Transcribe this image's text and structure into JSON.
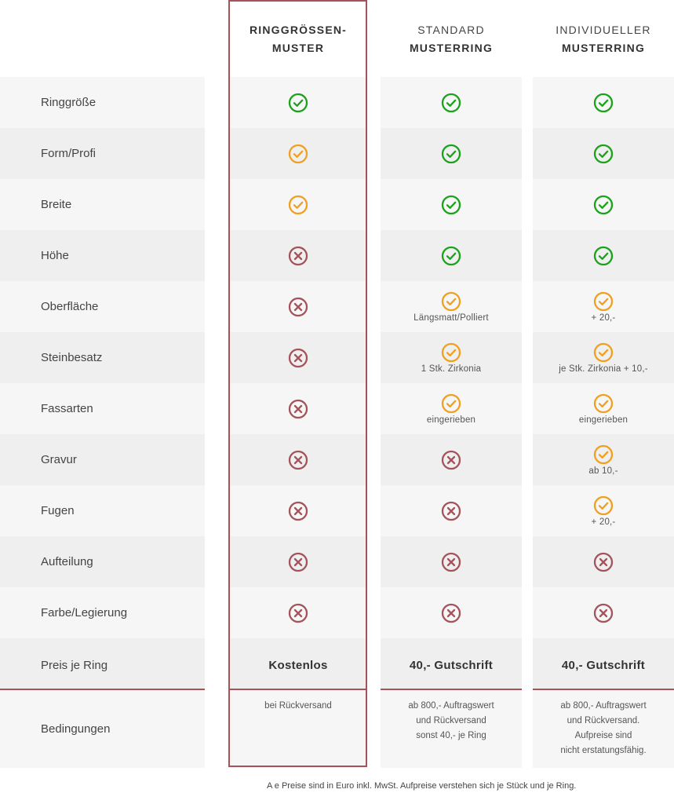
{
  "columns": [
    {
      "line1": "RINGGRÖSSEN-",
      "line2": "MUSTER"
    },
    {
      "line1": "STANDARD",
      "line2": "MUSTERRING"
    },
    {
      "line1": "INDIVIDUELLER",
      "line2": "MUSTERRING"
    }
  ],
  "rows": [
    {
      "label": "Ringgröße",
      "cells": [
        {
          "status": "green"
        },
        {
          "status": "green"
        },
        {
          "status": "green"
        }
      ]
    },
    {
      "label": "Form/Profi",
      "cells": [
        {
          "status": "orange"
        },
        {
          "status": "green"
        },
        {
          "status": "green"
        }
      ]
    },
    {
      "label": "Breite",
      "cells": [
        {
          "status": "orange"
        },
        {
          "status": "green"
        },
        {
          "status": "green"
        }
      ]
    },
    {
      "label": "Höhe",
      "cells": [
        {
          "status": "red"
        },
        {
          "status": "green"
        },
        {
          "status": "green"
        }
      ]
    },
    {
      "label": "Oberfläche",
      "cells": [
        {
          "status": "red"
        },
        {
          "status": "orange",
          "note": "Längsmatt/Polliert"
        },
        {
          "status": "orange",
          "note": "+ 20,-"
        }
      ]
    },
    {
      "label": "Steinbesatz",
      "cells": [
        {
          "status": "red"
        },
        {
          "status": "orange",
          "note": "1 Stk. Zirkonia"
        },
        {
          "status": "orange",
          "note": "je Stk. Zirkonia + 10,-"
        }
      ]
    },
    {
      "label": "Fassarten",
      "cells": [
        {
          "status": "red"
        },
        {
          "status": "orange",
          "note": "eingerieben"
        },
        {
          "status": "orange",
          "note": "eingerieben"
        }
      ]
    },
    {
      "label": "Gravur",
      "cells": [
        {
          "status": "red"
        },
        {
          "status": "red"
        },
        {
          "status": "orange",
          "note": "ab 10,-"
        }
      ]
    },
    {
      "label": "Fugen",
      "cells": [
        {
          "status": "red"
        },
        {
          "status": "red"
        },
        {
          "status": "orange",
          "note": "+ 20,-"
        }
      ]
    },
    {
      "label": "Aufteilung",
      "cells": [
        {
          "status": "red"
        },
        {
          "status": "red"
        },
        {
          "status": "red"
        }
      ]
    },
    {
      "label": "Farbe/Legierung",
      "cells": [
        {
          "status": "red"
        },
        {
          "status": "red"
        },
        {
          "status": "red"
        }
      ]
    }
  ],
  "price": {
    "label": "Preis je Ring",
    "values": [
      "Kostenlos",
      "40,- Gutschrift",
      "40,- Gutschrift"
    ]
  },
  "conditions": {
    "label": "Bedingungen",
    "values": [
      [
        "bei Rückversand"
      ],
      [
        "ab 800,- Auftragswert",
        "und Rückversand",
        "sonst 40,- je Ring"
      ],
      [
        "ab 800,- Auftragswert",
        "und Rückversand.",
        "Aufpreise sind",
        "nicht erstatungsfähig."
      ]
    ]
  },
  "footnote": "A  e Preise sind in Euro inkl. MwSt. Aufpreise verstehen sich je Stück und je Ring.",
  "colors": {
    "green": "#1aa31a",
    "orange": "#f0a020",
    "red": "#a4535a",
    "accent": "#a4535a"
  }
}
